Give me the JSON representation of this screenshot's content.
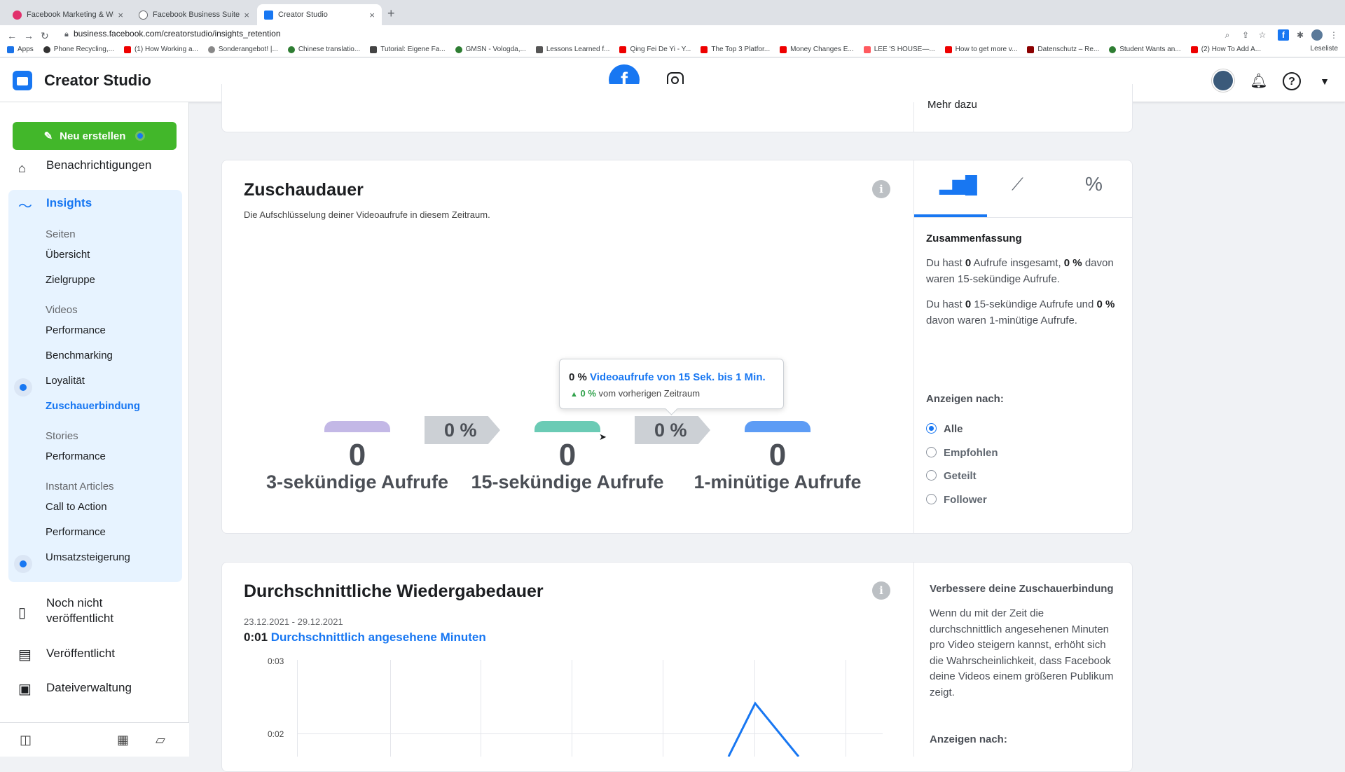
{
  "browser": {
    "tabs": [
      {
        "title": "Facebook Marketing & Werbe...",
        "color": "#e1306c"
      },
      {
        "title": "Facebook Business Suite",
        "color": "#65676b"
      },
      {
        "title": "Creator Studio",
        "color": "#1877f2"
      }
    ],
    "url": "business.facebook.com/creatorstudio/insights_retention",
    "bookmarks": [
      "Apps",
      "Phone Recycling,...",
      "(1) How Working a...",
      "Sonderangebot! |...",
      "Chinese translatio...",
      "Tutorial: Eigene Fa...",
      "GMSN - Vologda,...",
      "Lessons Learned f...",
      "Qing Fei De Yi - Y...",
      "The Top 3 Platfor...",
      "Money Changes E...",
      "LEE 'S HOUSE—...",
      "How to get more v...",
      "Datenschutz – Re...",
      "Student Wants an...",
      "(2) How To Add A..."
    ],
    "reading_list": "Leseliste"
  },
  "header": {
    "title": "Creator Studio"
  },
  "sidebar": {
    "new_button": "Neu erstellen",
    "notifications": "Benachrichtigungen",
    "insights": "Insights",
    "sections": [
      {
        "title": "Seiten",
        "items": [
          "Übersicht",
          "Zielgruppe"
        ]
      },
      {
        "title": "Videos",
        "items": [
          "Performance",
          "Benchmarking",
          "Loyalität",
          "Zuschauerbindung"
        ]
      },
      {
        "title": "Stories",
        "items": [
          "Performance"
        ]
      },
      {
        "title": "Instant Articles",
        "items": [
          "Call to Action",
          "Performance",
          "Umsatzsteigerung"
        ]
      }
    ],
    "nav": [
      "Noch nicht veröffentlicht",
      "Veröffentlicht",
      "Dateiverwaltung"
    ]
  },
  "top_card": {
    "link": "Mehr dazu"
  },
  "retention": {
    "title": "Zuschaudauer",
    "subtitle": "Die Aufschlüsselung deiner Videoaufrufe in diesem Zeitraum.",
    "steps": [
      {
        "value": "0",
        "label": "3-sekündige Aufrufe",
        "color": "#c3b8e6"
      },
      {
        "value": "0",
        "label": "15-sekündige Aufrufe",
        "color": "#6bcbb5"
      },
      {
        "value": "0",
        "label": "1-minütige Aufrufe",
        "color": "#5d9cf5"
      }
    ],
    "arrows": [
      "0 %",
      "0 %"
    ],
    "tooltip": {
      "pct": "0 %",
      "link": "Videoaufrufe von 15 Sek. bis 1 Min.",
      "change": "0 %",
      "change_text": "vom vorherigen Zeitraum"
    },
    "summary_title": "Zusammenfassung",
    "summary": [
      [
        "Du hast ",
        "0",
        " Aufrufe insgesamt, ",
        "0 %",
        " davon waren 15-sekündige Aufrufe."
      ],
      [
        "Du hast ",
        "0",
        " 15-sekündige Aufrufe und ",
        "0 %",
        " davon waren 1-minütige Aufrufe."
      ]
    ],
    "filter_title": "Anzeigen nach:",
    "filters": [
      "Alle",
      "Empfohlen",
      "Geteilt",
      "Follower"
    ],
    "selected_filter": "Alle"
  },
  "avg": {
    "title": "Durchschnittliche Wiedergabedauer",
    "daterange": "23.12.2021 - 29.12.2021",
    "value": "0:01",
    "value_label": "Durchschnittlich angesehene Minuten",
    "y_ticks": [
      "0:03",
      "0:02"
    ],
    "right_title": "Verbessere deine Zuschauerbindung",
    "right_text": "Wenn du mit der Zeit die durchschnittlich angesehenen Minuten pro Video steigern kannst, erhöht sich die Wahrscheinlichkeit, dass Facebook deine Videos einem größeren Publikum zeigt.",
    "right_filter": "Anzeigen nach:"
  }
}
